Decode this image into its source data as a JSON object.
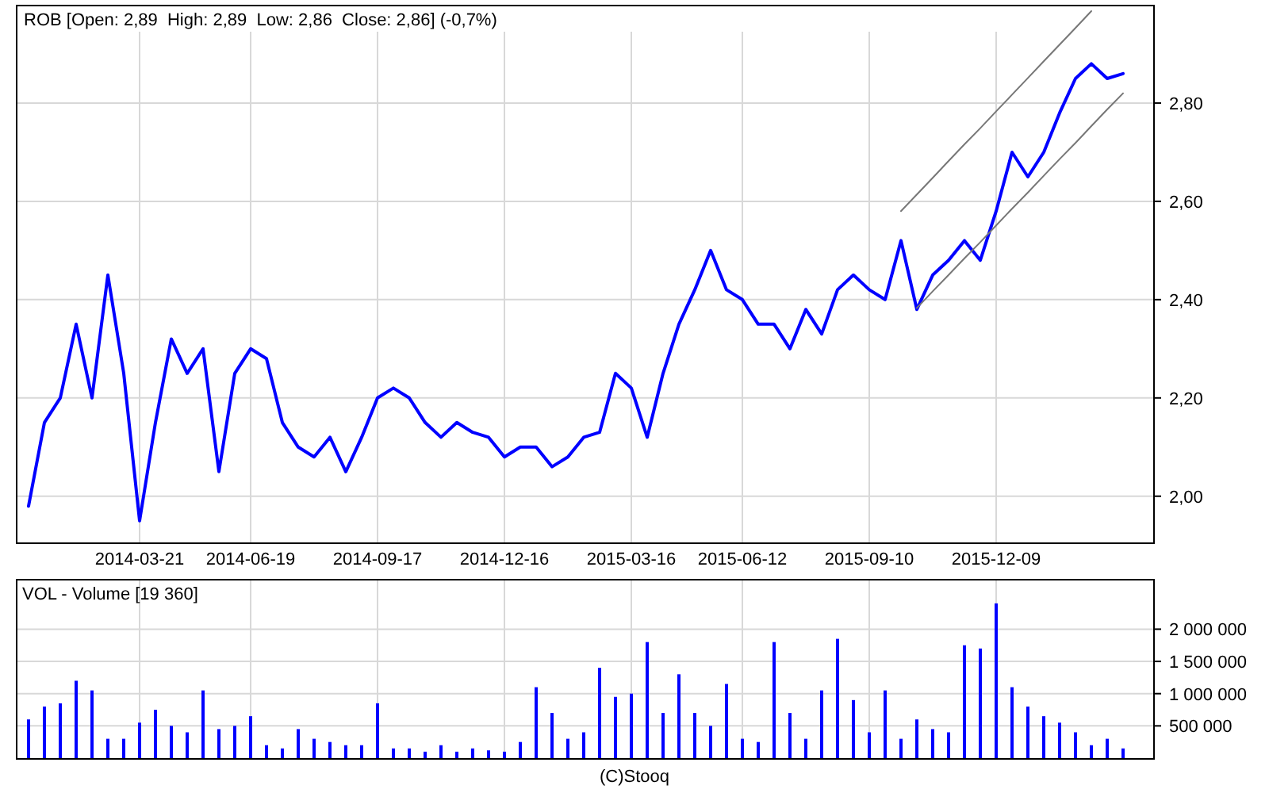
{
  "price_panel": {
    "chart_data": {
      "type": "line",
      "title": "ROB [Open: 2,89  High: 2,89  Low: 2,86  Close: 2,86] (-0,7%)",
      "categories": [
        null,
        null,
        null,
        null,
        null,
        null,
        null,
        "2014-03-21",
        null,
        null,
        null,
        null,
        null,
        null,
        "2014-06-19",
        null,
        null,
        null,
        null,
        null,
        null,
        null,
        "2014-09-17",
        null,
        null,
        null,
        null,
        null,
        null,
        null,
        "2014-12-16",
        null,
        null,
        null,
        null,
        null,
        null,
        null,
        "2015-03-16",
        null,
        null,
        null,
        null,
        null,
        null,
        "2015-06-12",
        null,
        null,
        null,
        null,
        null,
        null,
        null,
        "2015-09-10",
        null,
        null,
        null,
        null,
        null,
        null,
        null,
        "2015-12-09",
        null,
        null,
        null,
        null,
        null,
        null,
        null,
        null
      ],
      "series": [
        {
          "color": "#0000ff",
          "values": [
            1.98,
            2.15,
            2.2,
            2.35,
            2.2,
            2.45,
            2.25,
            1.95,
            2.15,
            2.32,
            2.25,
            2.3,
            2.05,
            2.25,
            2.3,
            2.28,
            2.15,
            2.1,
            2.08,
            2.12,
            2.05,
            2.12,
            2.2,
            2.22,
            2.2,
            2.15,
            2.12,
            2.15,
            2.13,
            2.12,
            2.08,
            2.1,
            2.1,
            2.06,
            2.08,
            2.12,
            2.13,
            2.25,
            2.22,
            2.12,
            2.25,
            2.35,
            2.42,
            2.5,
            2.42,
            2.4,
            2.35,
            2.35,
            2.3,
            2.38,
            2.33,
            2.42,
            2.45,
            2.42,
            2.4,
            2.52,
            2.38,
            2.45,
            2.48,
            2.52,
            2.48,
            2.58,
            2.7,
            2.65,
            2.7,
            2.78,
            2.85,
            2.88,
            2.85,
            2.86
          ]
        },
        {
          "color": "#777777",
          "values": [
            null,
            null,
            null,
            null,
            null,
            null,
            null,
            null,
            null,
            null,
            null,
            null,
            null,
            null,
            null,
            null,
            null,
            null,
            null,
            null,
            null,
            null,
            null,
            null,
            null,
            null,
            null,
            null,
            null,
            null,
            null,
            null,
            null,
            null,
            null,
            null,
            null,
            null,
            null,
            null,
            null,
            null,
            null,
            null,
            null,
            null,
            null,
            null,
            null,
            null,
            null,
            null,
            null,
            null,
            null,
            2.58,
            2.614,
            2.648,
            2.682,
            2.716,
            2.749,
            2.783,
            2.817,
            2.851,
            2.885,
            2.919,
            2.953,
            2.987,
            null,
            null
          ]
        },
        {
          "color": "#777777",
          "values": [
            null,
            null,
            null,
            null,
            null,
            null,
            null,
            null,
            null,
            null,
            null,
            null,
            null,
            null,
            null,
            null,
            null,
            null,
            null,
            null,
            null,
            null,
            null,
            null,
            null,
            null,
            null,
            null,
            null,
            null,
            null,
            null,
            null,
            null,
            null,
            null,
            null,
            null,
            null,
            null,
            null,
            null,
            null,
            null,
            null,
            null,
            null,
            null,
            null,
            null,
            null,
            null,
            null,
            null,
            null,
            null,
            2.383,
            2.417,
            2.45,
            2.484,
            2.517,
            2.551,
            2.585,
            2.618,
            2.652,
            2.686,
            2.719,
            2.753,
            2.787,
            2.82
          ]
        }
      ],
      "grid": true,
      "ylim": [
        1.906,
        3.0
      ],
      "yticks": [
        {
          "value": 2.0,
          "label": "2,00"
        },
        {
          "value": 2.2,
          "label": "2,20"
        },
        {
          "value": 2.4,
          "label": "2,40"
        },
        {
          "value": 2.6,
          "label": "2,60"
        },
        {
          "value": 2.8,
          "label": "2,80"
        }
      ]
    }
  },
  "volume_panel": {
    "chart_data": {
      "type": "bar",
      "title": "VOL - Volume [19 360]",
      "series": [
        {
          "color": "#0000ff",
          "values": [
            600000,
            800000,
            850000,
            1200000,
            1050000,
            300000,
            300000,
            550000,
            750000,
            500000,
            400000,
            1050000,
            450000,
            500000,
            650000,
            200000,
            150000,
            450000,
            300000,
            250000,
            200000,
            200000,
            850000,
            150000,
            150000,
            100000,
            200000,
            100000,
            150000,
            120000,
            100000,
            250000,
            1100000,
            700000,
            300000,
            400000,
            1400000,
            950000,
            1000000,
            1800000,
            700000,
            1300000,
            700000,
            500000,
            1150000,
            300000,
            250000,
            1800000,
            700000,
            300000,
            1050000,
            1850000,
            900000,
            400000,
            1050000,
            300000,
            600000,
            450000,
            400000,
            1750000,
            1700000,
            2400000,
            1100000,
            800000,
            650000,
            550000,
            400000,
            200000,
            300000,
            150000
          ]
        }
      ],
      "ylim": [
        0,
        2780000
      ],
      "grid": true,
      "yticks": [
        {
          "value": 500000,
          "label": "500 000"
        },
        {
          "value": 1000000,
          "label": "1 000 000"
        },
        {
          "value": 1500000,
          "label": "1 500 000"
        },
        {
          "value": 2000000,
          "label": "2 000 000"
        }
      ]
    }
  },
  "footer": "(C)Stooq"
}
